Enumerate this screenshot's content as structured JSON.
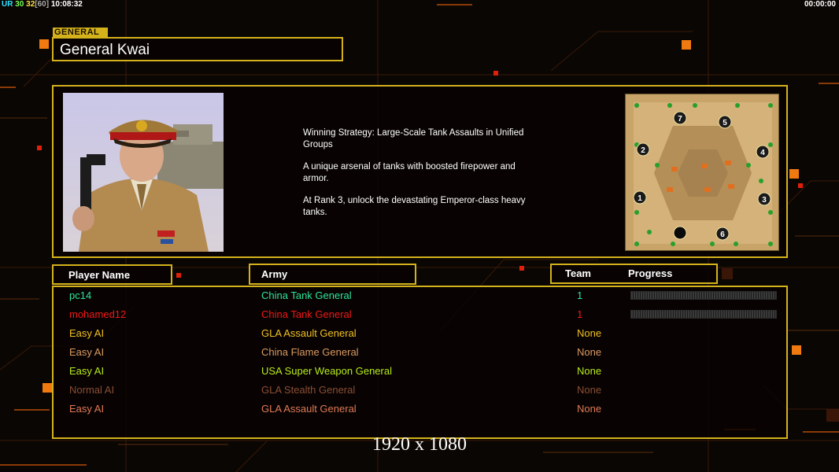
{
  "hud": {
    "left_prefix": "UR",
    "left_val1": "30",
    "left_val2": "32",
    "left_val3": "[60]",
    "left_time": "10:08:32",
    "right_time": "00:00:00"
  },
  "general_tag": "GENERAL",
  "general_name": "General Kwai",
  "description": [
    "Winning Strategy: Large-Scale Tank Assaults in Unified\n Groups",
    "A unique arsenal of tanks with boosted firepower and\n armor.",
    "At Rank 3, unlock the devastating Emperor-class heavy\n tanks."
  ],
  "map": {
    "slots": [
      "1",
      "2",
      "3",
      "4",
      "5",
      "6",
      "7"
    ]
  },
  "headers": {
    "player_name": "Player Name",
    "army": "Army",
    "team": "Team",
    "progress": "Progress"
  },
  "players": [
    {
      "name": "pc14",
      "army": "China Tank General",
      "team": "1",
      "color": "#2ee59a",
      "progress": true
    },
    {
      "name": "mohamed12",
      "army": "China Tank General",
      "team": "1",
      "color": "#f01818",
      "progress": true
    },
    {
      "name": "Easy AI",
      "army": "GLA Assault General",
      "team": "None",
      "color": "#f0c020",
      "progress": false
    },
    {
      "name": "Easy AI",
      "army": "China Flame General",
      "team": "None",
      "color": "#d99a62",
      "progress": false
    },
    {
      "name": "Easy AI",
      "army": "USA Super Weapon General",
      "team": "None",
      "color": "#b8ec1c",
      "progress": false
    },
    {
      "name": "Normal AI",
      "army": "GLA Stealth General",
      "team": "None",
      "color": "#8a4e35",
      "progress": false
    },
    {
      "name": "Easy AI",
      "army": "GLA Assault General",
      "team": "None",
      "color": "#e07a56",
      "progress": false
    }
  ],
  "resolution_label": "1920 x 1080",
  "colors": {
    "accent": "#d4b21c",
    "orange": "#f07a10"
  }
}
